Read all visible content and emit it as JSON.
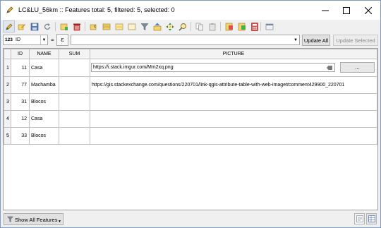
{
  "window": {
    "title": "LC&LU_56km :: Features total: 5, filtered: 5, selected: 0",
    "title_bar_bg": "#ffffff",
    "icons": [
      "pencil-icon",
      "minimize-icon",
      "maximize-icon",
      "close-icon"
    ]
  },
  "toolbar": {
    "buttons": [
      "toggle-editing-icon",
      "multi-edit-icon",
      "save-edits-icon",
      "reload-icon",
      "add-feature-icon",
      "delete-feature-icon",
      "select-by-expression-icon",
      "select-all-icon",
      "invert-selection-icon",
      "deselect-all-icon",
      "filter-selection-icon",
      "move-selection-top-icon",
      "pan-to-selection-icon",
      "zoom-to-selection-icon",
      "copy-rows-icon",
      "paste-features-icon",
      "delete-field-icon",
      "new-field-icon",
      "field-calculator-icon",
      "conditional-formatting-icon",
      "dock-icon"
    ]
  },
  "field_calc": {
    "field_type": "123",
    "field_name": "ID",
    "equals": "=",
    "expression_symbol": "ε",
    "expression_value": "",
    "update_all": "Update All",
    "update_selected": "Update Selected"
  },
  "table": {
    "columns": [
      "ID",
      "NAME",
      "SUM",
      "PICTURE"
    ],
    "rows": [
      {
        "num": "1",
        "id": "11",
        "name": "Casa",
        "sum": "",
        "picture": "https://i.stack.imgur.com/Mm2xq.png"
      },
      {
        "num": "2",
        "id": "77",
        "name": "Machamba",
        "sum": "",
        "picture": "https://gis.stackexchange.com/questions/220701/link-qgis-attribute-table-with-web-image#comment429900_220701"
      },
      {
        "num": "3",
        "id": "31",
        "name": "Blocos",
        "sum": "",
        "picture": ""
      },
      {
        "num": "4",
        "id": "12",
        "name": "Casa",
        "sum": "",
        "picture": ""
      },
      {
        "num": "5",
        "id": "33",
        "name": "Blocos",
        "sum": "",
        "picture": ""
      }
    ],
    "browse_label": "..."
  },
  "bottom": {
    "show_all": "Show All Features",
    "view_buttons": [
      "form-view-icon",
      "table-view-icon"
    ]
  }
}
